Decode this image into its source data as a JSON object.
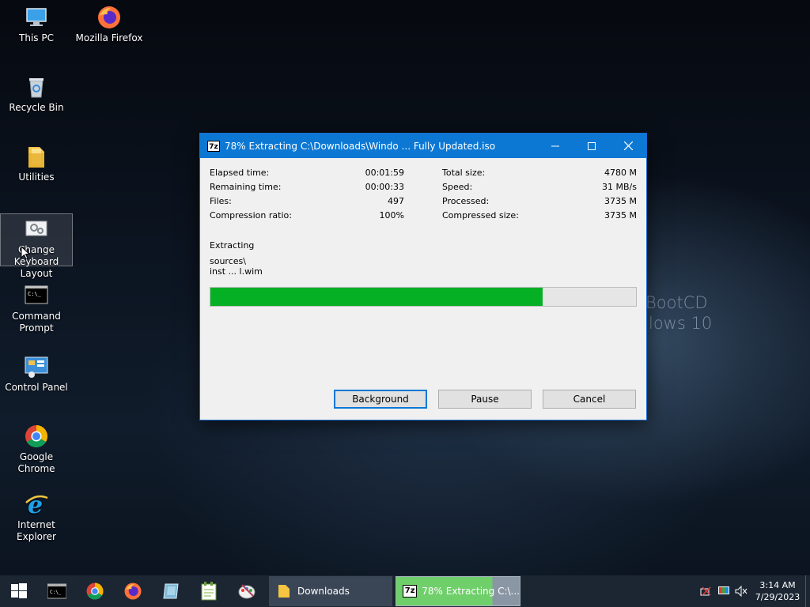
{
  "desktop": {
    "icons": [
      {
        "label": "This PC"
      },
      {
        "label": "Mozilla Firefox"
      },
      {
        "label": "Recycle Bin"
      },
      {
        "label": "Utilities"
      },
      {
        "label": "Change Keyboard Layout"
      },
      {
        "label": "Command Prompt"
      },
      {
        "label": "Control Panel"
      },
      {
        "label": "Google Chrome"
      },
      {
        "label": "Internet Explorer"
      }
    ],
    "wallpaper_text": [
      "BootCD",
      "lows 10"
    ]
  },
  "dialog": {
    "app_icon": "7z",
    "title": "78% Extracting C:\\Downloads\\Windo ...  Fully Updated.iso",
    "stats_left": [
      {
        "label": "Elapsed time:",
        "value": "00:01:59"
      },
      {
        "label": "Remaining time:",
        "value": "00:00:33"
      },
      {
        "label": "Files:",
        "value": "497"
      },
      {
        "label": "Compression ratio:",
        "value": "100%"
      }
    ],
    "stats_right": [
      {
        "label": "Total size:",
        "value": "4780 M"
      },
      {
        "label": "Speed:",
        "value": "31 MB/s"
      },
      {
        "label": "Processed:",
        "value": "3735 M"
      },
      {
        "label": "Compressed size:",
        "value": "3735 M"
      }
    ],
    "status": "Extracting",
    "current_folder": "sources\\",
    "current_file": "inst ... l.wim",
    "progress_percent": 78,
    "buttons": {
      "background": "Background",
      "pause": "Pause",
      "cancel": "Cancel"
    }
  },
  "taskbar": {
    "tasks": [
      {
        "label": "Downloads"
      },
      {
        "label": "78% Extracting C:\\..."
      }
    ],
    "clock": {
      "time": "3:14 AM",
      "date": "7/29/2023"
    }
  },
  "colors": {
    "titlebar": "#0c78d4",
    "progress": "#06b025",
    "taskbar": "#1c2633"
  }
}
